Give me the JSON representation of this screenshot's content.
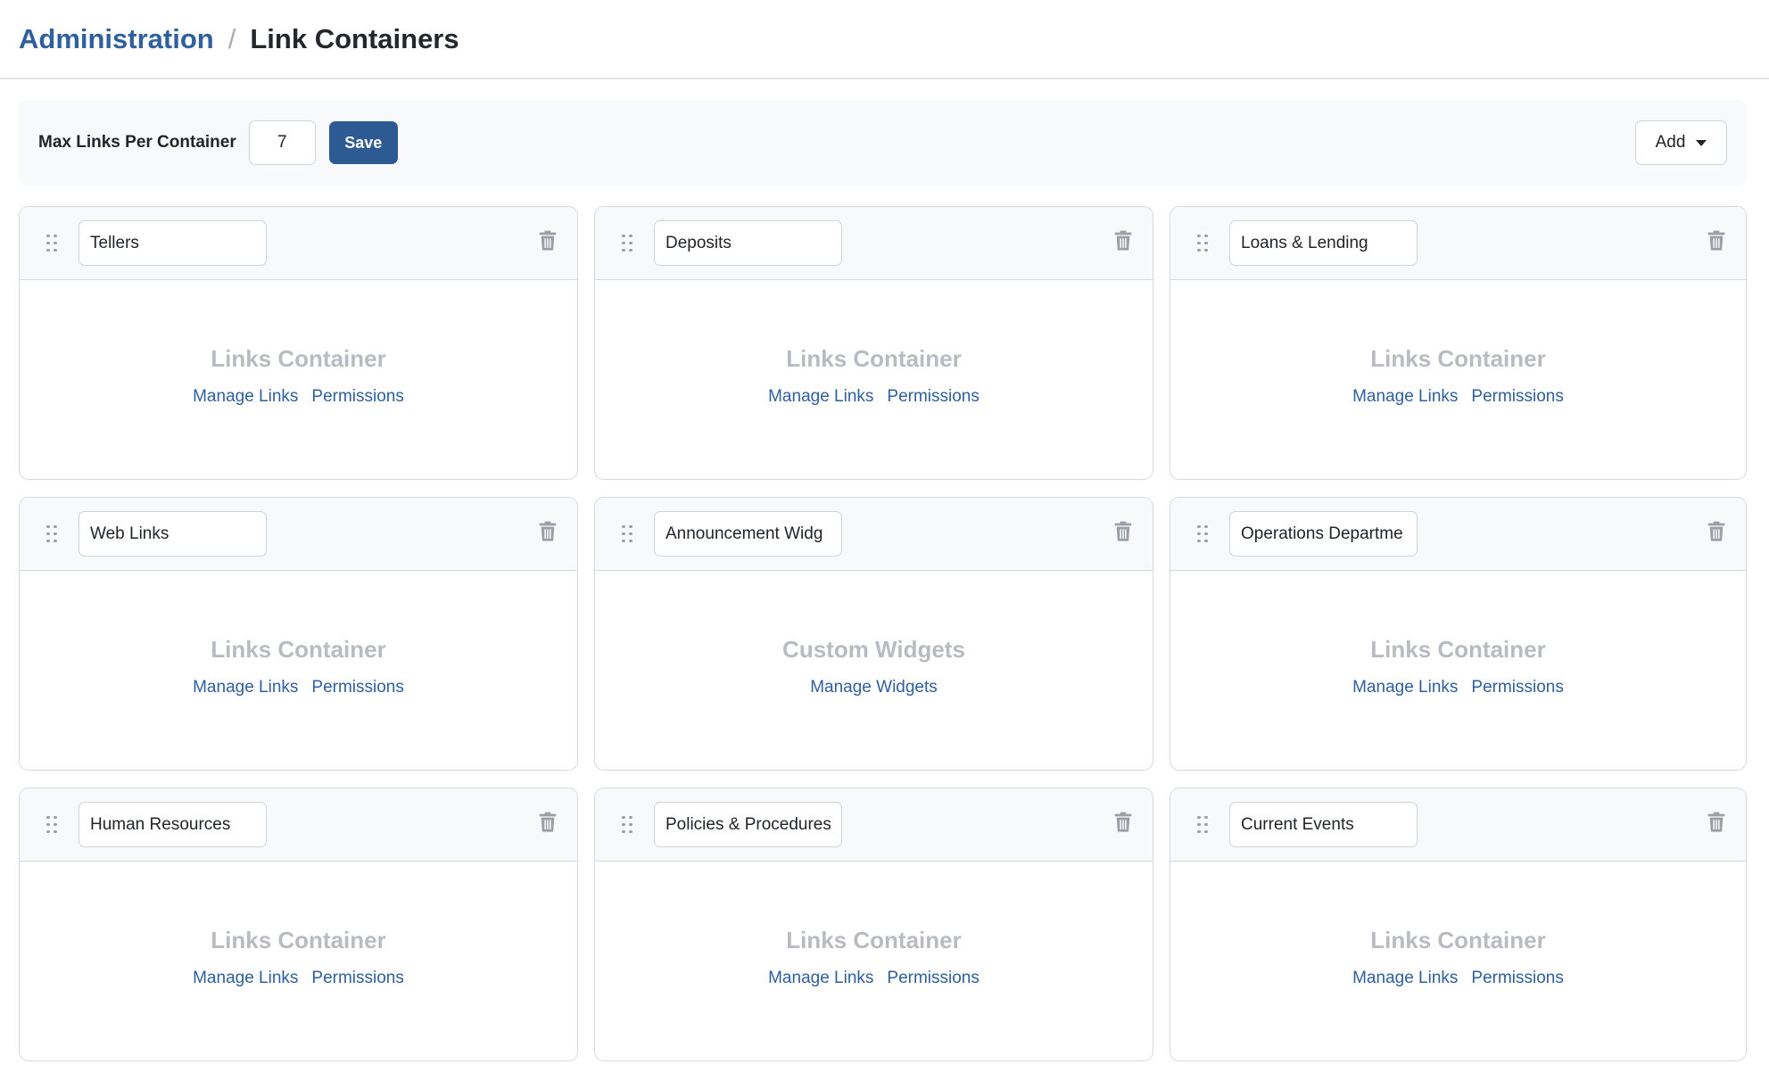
{
  "breadcrumb": {
    "parent": "Administration",
    "separator": "/",
    "current": "Link Containers"
  },
  "toolbar": {
    "max_label": "Max Links Per Container",
    "max_value": "7",
    "save_label": "Save",
    "add_label": "Add"
  },
  "containers": [
    {
      "name": "Tellers",
      "type": "Links Container",
      "link1": "Manage Links",
      "link2": "Permissions"
    },
    {
      "name": "Deposits",
      "type": "Links Container",
      "link1": "Manage Links",
      "link2": "Permissions"
    },
    {
      "name": "Loans & Lending",
      "type": "Links Container",
      "link1": "Manage Links",
      "link2": "Permissions"
    },
    {
      "name": "Web Links",
      "type": "Links Container",
      "link1": "Manage Links",
      "link2": "Permissions"
    },
    {
      "name": "Announcement Widg",
      "type": "Custom Widgets",
      "link1": "Manage Widgets"
    },
    {
      "name": "Operations Departme",
      "type": "Links Container",
      "link1": "Manage Links",
      "link2": "Permissions"
    },
    {
      "name": "Human Resources",
      "type": "Links Container",
      "link1": "Manage Links",
      "link2": "Permissions"
    },
    {
      "name": "Policies & Procedures",
      "type": "Links Container",
      "link1": "Manage Links",
      "link2": "Permissions"
    },
    {
      "name": "Current Events",
      "type": "Links Container",
      "link1": "Manage Links",
      "link2": "Permissions"
    }
  ],
  "colors": {
    "accent": "#2f5f9e",
    "save_button": "#2e5a93",
    "muted_title": "#b8bcc1",
    "header_bg": "#f8f9fa",
    "border": "#d5d8dc"
  },
  "icons": {
    "drag": "drag-handle-icon",
    "delete": "trash-icon",
    "dropdown": "caret-down-icon"
  }
}
